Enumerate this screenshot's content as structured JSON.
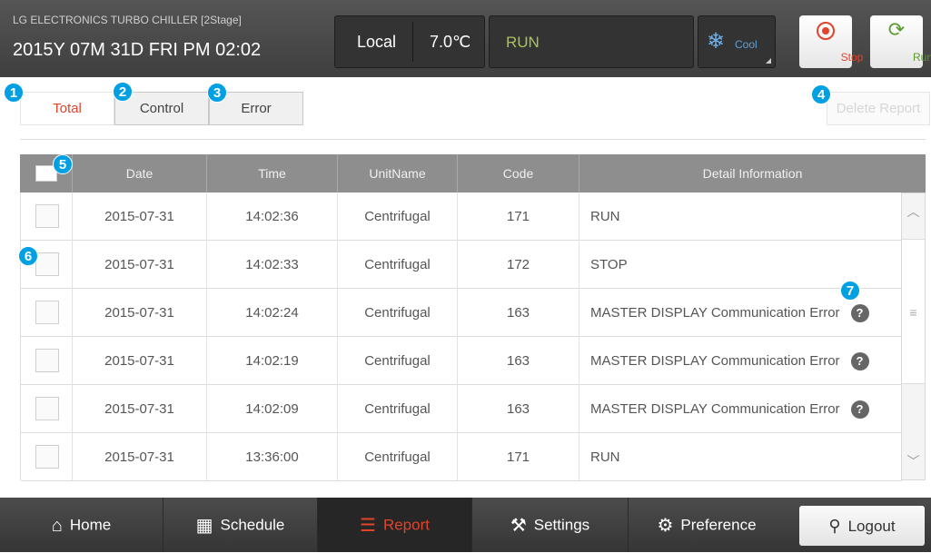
{
  "header": {
    "model": "LG ELECTRONICS TURBO CHILLER [2Stage]",
    "datetime": "2015Y 07M 31D  FRI PM 02:02",
    "mode": "Local",
    "temperature": "7.0℃",
    "status": "RUN",
    "operation": "Cool",
    "stop_label": "Stop",
    "run_label": "Run"
  },
  "tabs": [
    {
      "label": "Total"
    },
    {
      "label": "Control"
    },
    {
      "label": "Error"
    }
  ],
  "delete_label": "Delete Report",
  "table": {
    "columns": [
      "Date",
      "Time",
      "UnitName",
      "Code",
      "Detail Information"
    ],
    "rows": [
      {
        "date": "2015-07-31",
        "time": "14:02:36",
        "unit": "Centrifugal",
        "code": "171",
        "detail": "RUN"
      },
      {
        "date": "2015-07-31",
        "time": "14:02:33",
        "unit": "Centrifugal",
        "code": "172",
        "detail": "STOP"
      },
      {
        "date": "2015-07-31",
        "time": "14:02:24",
        "unit": "Centrifugal",
        "code": "163",
        "detail": "MASTER  DISPLAY Communication Error"
      },
      {
        "date": "2015-07-31",
        "time": "14:02:19",
        "unit": "Centrifugal",
        "code": "163",
        "detail": "MASTER  DISPLAY Communication Error"
      },
      {
        "date": "2015-07-31",
        "time": "14:02:09",
        "unit": "Centrifugal",
        "code": "163",
        "detail": "MASTER  DISPLAY Communication Error"
      },
      {
        "date": "2015-07-31",
        "time": "13:36:00",
        "unit": "Centrifugal",
        "code": "171",
        "detail": "RUN"
      }
    ]
  },
  "badges": [
    "1",
    "2",
    "3",
    "4",
    "5",
    "6",
    "7"
  ],
  "nav": {
    "home": "Home",
    "schedule": "Schedule",
    "report": "Report",
    "settings": "Settings",
    "preference": "Preference",
    "logout": "Logout"
  },
  "colors": {
    "accent_red": "#e0442a",
    "run_green": "#a8c35a",
    "badge_blue": "#00a0e3"
  }
}
